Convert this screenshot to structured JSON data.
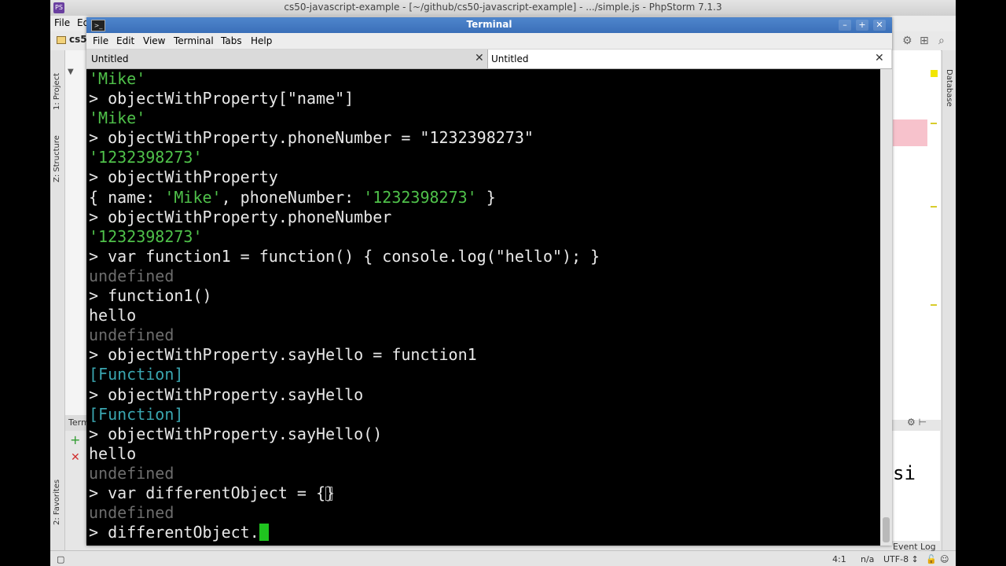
{
  "ide": {
    "title": "cs50-javascript-example - [~/github/cs50-javascript-example] - .../simple.js - PhpStorm 7.1.3",
    "menu": [
      "File",
      "Ed"
    ],
    "project_label": "cs5",
    "left_tabs": [
      "1: Project",
      "Z: Structure",
      "2: Favorites"
    ],
    "right_tab": "Database",
    "terminal_panel_label": "Term",
    "right_editor_text": "si",
    "status": {
      "position": "4:1",
      "na": "n/a",
      "encoding": "UTF-8 ↕",
      "event_log": "Event Log"
    }
  },
  "terminal": {
    "title": "Terminal",
    "menu": [
      "File",
      "Edit",
      "View",
      "Terminal",
      "Tabs",
      "Help"
    ],
    "tabs": [
      {
        "label": "Untitled",
        "active": false
      },
      {
        "label": "Untitled",
        "active": true
      }
    ],
    "lines": [
      {
        "type": "str",
        "text": "'Mike'"
      },
      {
        "type": "cmd",
        "text": "> objectWithProperty[\"name\"]"
      },
      {
        "type": "str",
        "text": "'Mike'"
      },
      {
        "type": "cmd",
        "text": "> objectWithProperty.phoneNumber = \"1232398273\""
      },
      {
        "type": "str",
        "text": "'1232398273'"
      },
      {
        "type": "cmd",
        "text": "> objectWithProperty"
      },
      {
        "type": "obj",
        "parts": [
          "{ name: ",
          "'Mike'",
          ", phoneNumber: ",
          "'1232398273'",
          " }"
        ]
      },
      {
        "type": "cmd",
        "text": "> objectWithProperty.phoneNumber"
      },
      {
        "type": "str",
        "text": "'1232398273'"
      },
      {
        "type": "cmd",
        "text": "> var function1 = function() { console.log(\"hello\"); }"
      },
      {
        "type": "undef",
        "text": "undefined"
      },
      {
        "type": "cmd",
        "text": "> function1()"
      },
      {
        "type": "out",
        "text": "hello"
      },
      {
        "type": "undef",
        "text": "undefined"
      },
      {
        "type": "cmd",
        "text": "> objectWithProperty.sayHello = function1"
      },
      {
        "type": "fn",
        "text": "[Function]"
      },
      {
        "type": "cmd",
        "text": "> objectWithProperty.sayHello"
      },
      {
        "type": "fn",
        "text": "[Function]"
      },
      {
        "type": "cmd",
        "text": "> objectWithProperty.sayHello()"
      },
      {
        "type": "out",
        "text": "hello"
      },
      {
        "type": "undef",
        "text": "undefined"
      },
      {
        "type": "cmd",
        "text": "> var differentObject = {}",
        "text_cursor": true
      },
      {
        "type": "undef",
        "text": "undefined"
      },
      {
        "type": "prompt",
        "text": "> differentObject."
      }
    ]
  }
}
